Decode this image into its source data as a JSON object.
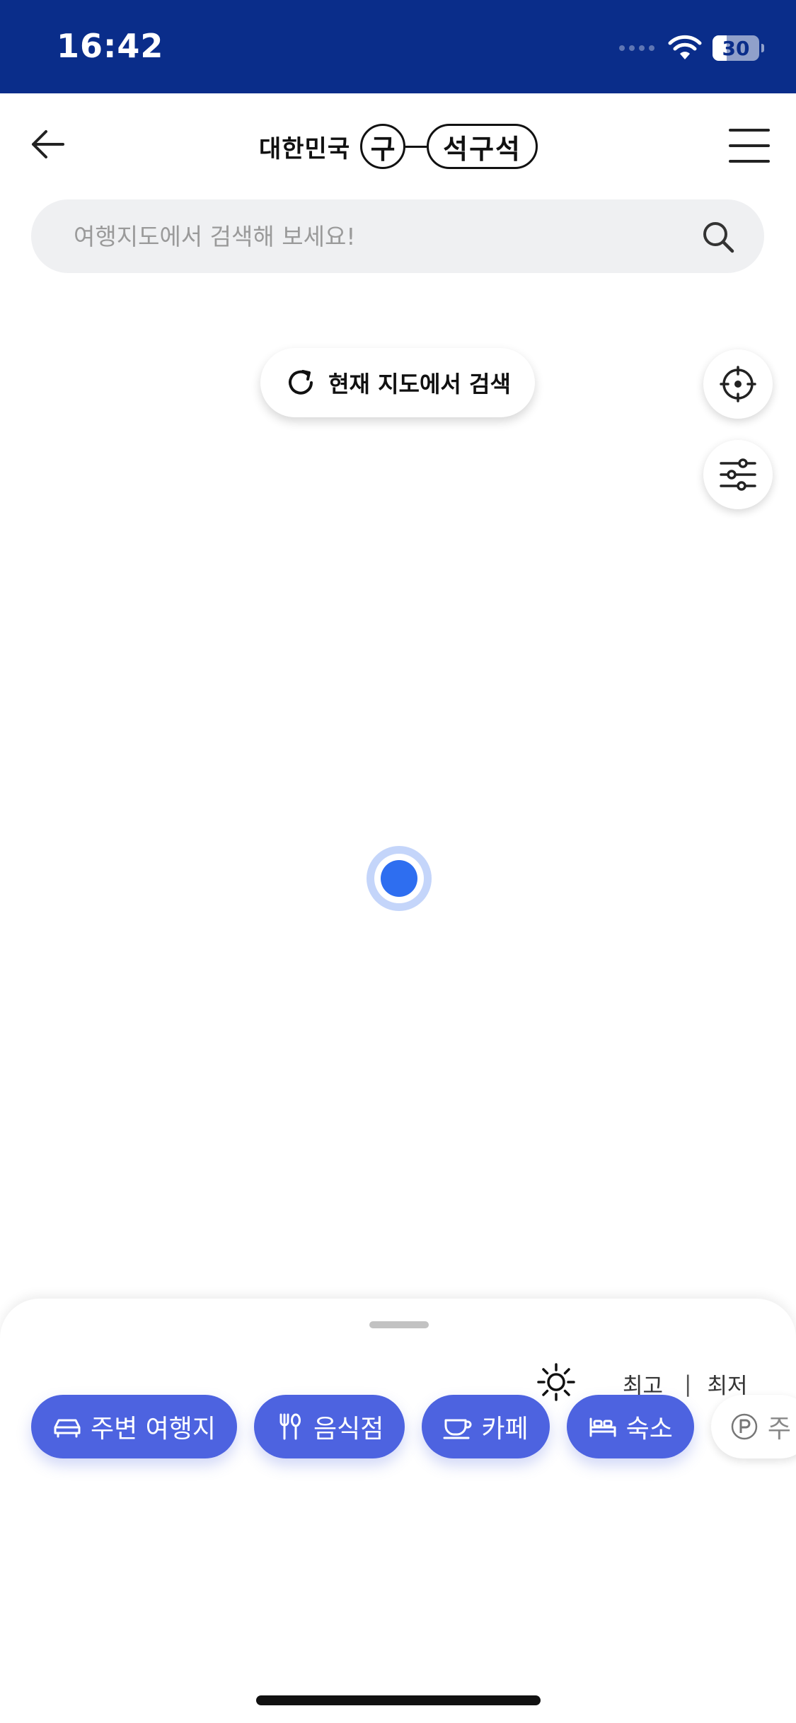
{
  "status_bar": {
    "time": "16:42",
    "battery_level": "30",
    "icons": [
      "signal-icon",
      "wifi-icon",
      "battery-icon"
    ]
  },
  "header": {
    "back_icon": "arrow-left-icon",
    "menu_icon": "hamburger-menu-icon",
    "logo": {
      "country": "대한민국",
      "circle_char": "구",
      "pill_text": "석구석"
    }
  },
  "search": {
    "placeholder": "여행지도에서 검색해 보세요!",
    "icon": "search-icon"
  },
  "map": {
    "refresh_search_label": "현재 지도에서 검색",
    "refresh_icon": "refresh-icon",
    "locate_icon": "crosshair-icon",
    "filter_icon": "sliders-icon",
    "marker": "current-location-marker"
  },
  "bottom_sheet": {
    "weather_icon": "sun-icon",
    "temp_high_label": "최고",
    "temp_low_label": "최저",
    "temp_separator": "|",
    "chips": [
      {
        "label": "주변 여행지",
        "icon": "car-icon"
      },
      {
        "label": "음식점",
        "icon": "fork-spoon-icon"
      },
      {
        "label": "카페",
        "icon": "coffee-cup-icon"
      },
      {
        "label": "숙소",
        "icon": "bed-icon"
      },
      {
        "label": "주",
        "icon": "parking-icon"
      }
    ]
  },
  "colors": {
    "status_bar": "#0a2d8a",
    "chip": "#4d63e0",
    "location_dot": "#2e6ef0",
    "search_bg": "#eff0f2"
  }
}
